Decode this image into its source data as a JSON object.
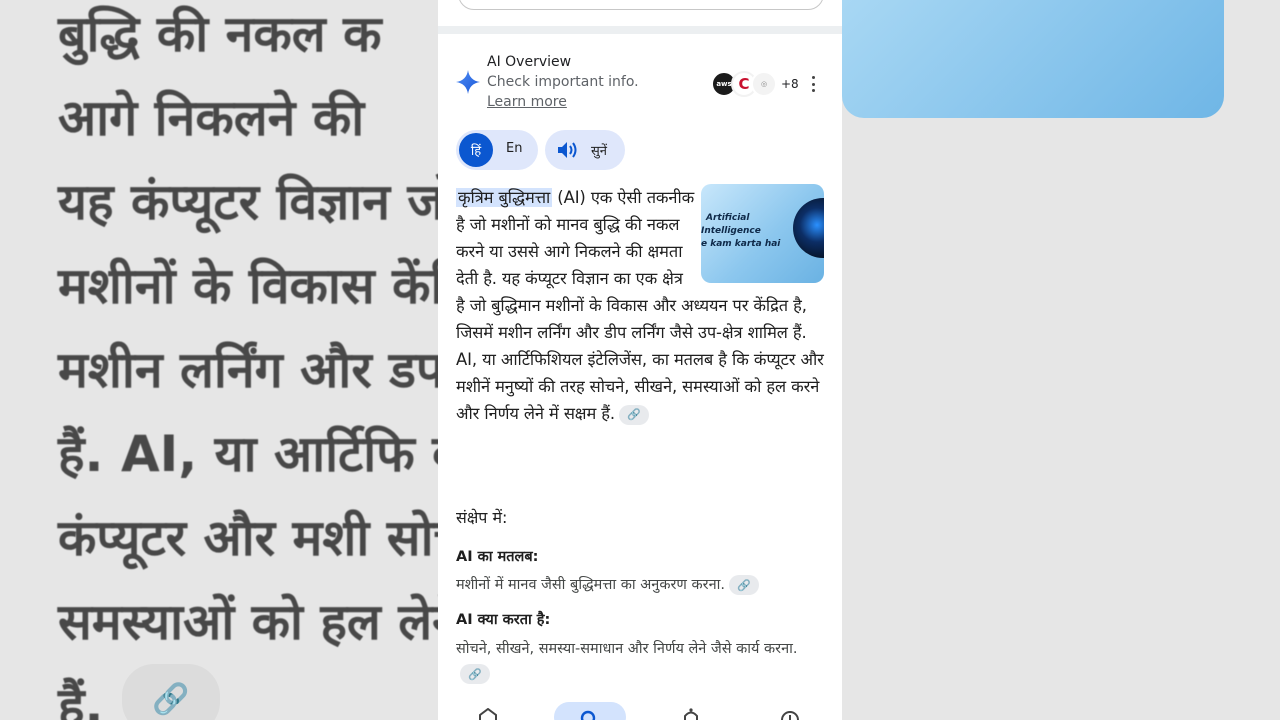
{
  "background": {
    "lines": [
      "बुद्धि की नकल क",
      "आगे निकलने की",
      "यह कंप्यूटर विज्ञान                        जो बुद्धिमान",
      "मशीनों के विकास                        केंद्रित है, जिसमें",
      "मशीन लर्निंग और                          डप-क्षेत्र शामिल",
      "हैं. AI, या आर्टिफि                          का मतलब है कि",
      "कंप्यूटर और मशी                          सोचने, सीखने,",
      "समस्याओं को हल                           लेने में सक्षम",
      "हैं."
    ],
    "thumb_text": "kam karta hai"
  },
  "ai_overview": {
    "title": "AI Overview",
    "subtitle": "Check important info.",
    "learn_more": "Learn more",
    "source_aws": "aws",
    "source_count": "+8"
  },
  "language": {
    "hindi": "हिं",
    "english": "En",
    "listen": "सुनें"
  },
  "thumbnail": {
    "line1": "Artificial",
    "line2": "Intelligence",
    "line3": "e kam karta hai"
  },
  "paragraph": {
    "lead": "कृत्रिम बुद्धिमत्ता",
    "rest": " (AI) एक ऐसी तकनीक है जो मशीनों को मानव बुद्धि की नकल करने या उससे आगे निकलने की क्षमता देती है. यह कंप्यूटर विज्ञान का एक क्षेत्र है जो बुद्धिमान मशीनों के विकास और अध्ययन पर केंद्रित है, जिसमें मशीन लर्निंग और डीप लर्निंग जैसे उप-क्षेत्र शामिल हैं. AI, या आर्टिफिशियल इंटेलिजेंस, का मतलब है कि कंप्यूटर और मशीनें मनुष्यों की तरह सोचने, सीखने, समस्याओं को हल करने और निर्णय लेने में सक्षम हैं."
  },
  "summary": {
    "heading": "संक्षेप में:",
    "items": [
      {
        "title": "AI का मतलब:",
        "text": "मशीनों में मानव जैसी बुद्धिमत्ता का अनुकरण करना."
      },
      {
        "title": "AI क्या करता है:",
        "text": "सोचने, सीखने, समस्या-समाधान और निर्णय लेने जैसे कार्य करना."
      }
    ]
  },
  "icons": {
    "link": "link-icon",
    "spark": "gemini-spark-icon",
    "speaker": "speaker-icon",
    "menu": "more-vert-icon"
  },
  "colors": {
    "accent": "#0b57d0",
    "chip": "#dfe7fb",
    "highlight": "#d3e3fd"
  }
}
